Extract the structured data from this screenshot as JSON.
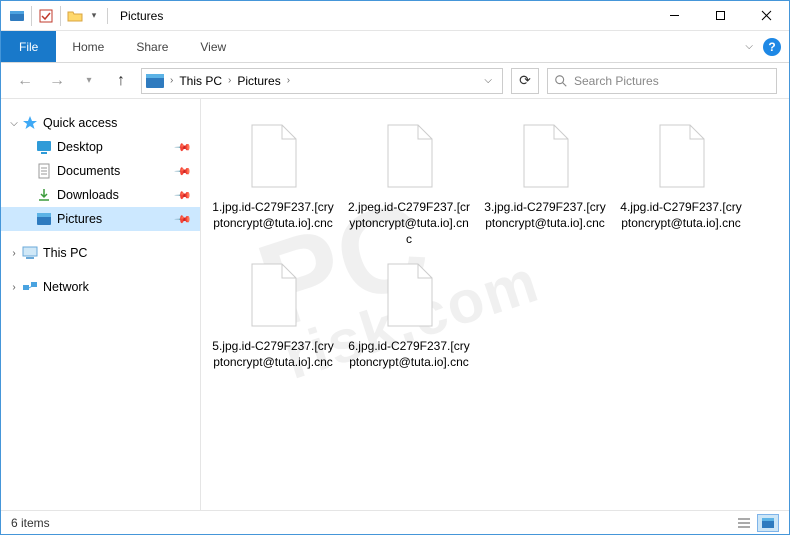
{
  "title": "Pictures",
  "ribbon": {
    "file": "File",
    "tabs": [
      "Home",
      "Share",
      "View"
    ]
  },
  "breadcrumb": {
    "items": [
      "This PC",
      "Pictures"
    ]
  },
  "search": {
    "placeholder": "Search Pictures"
  },
  "sidebar": {
    "quick_access": {
      "label": "Quick access",
      "items": [
        {
          "label": "Desktop",
          "pinned": true,
          "icon": "desktop"
        },
        {
          "label": "Documents",
          "pinned": true,
          "icon": "doc"
        },
        {
          "label": "Downloads",
          "pinned": true,
          "icon": "down"
        },
        {
          "label": "Pictures",
          "pinned": true,
          "icon": "pic",
          "selected": true
        }
      ]
    },
    "this_pc": {
      "label": "This PC"
    },
    "network": {
      "label": "Network"
    }
  },
  "files": [
    {
      "name": "1.jpg.id-C279F237.[cryptoncrypt@tuta.io].cnc"
    },
    {
      "name": "2.jpeg.id-C279F237.[cryptoncrypt@tuta.io].cnc"
    },
    {
      "name": "3.jpg.id-C279F237.[cryptoncrypt@tuta.io].cnc"
    },
    {
      "name": "4.jpg.id-C279F237.[cryptoncrypt@tuta.io].cnc"
    },
    {
      "name": "5.jpg.id-C279F237.[cryptoncrypt@tuta.io].cnc"
    },
    {
      "name": "6.jpg.id-C279F237.[cryptoncrypt@tuta.io].cnc"
    }
  ],
  "status": {
    "text": "6 items"
  },
  "watermark": {
    "main": "PC",
    "sub": "risk.com"
  }
}
